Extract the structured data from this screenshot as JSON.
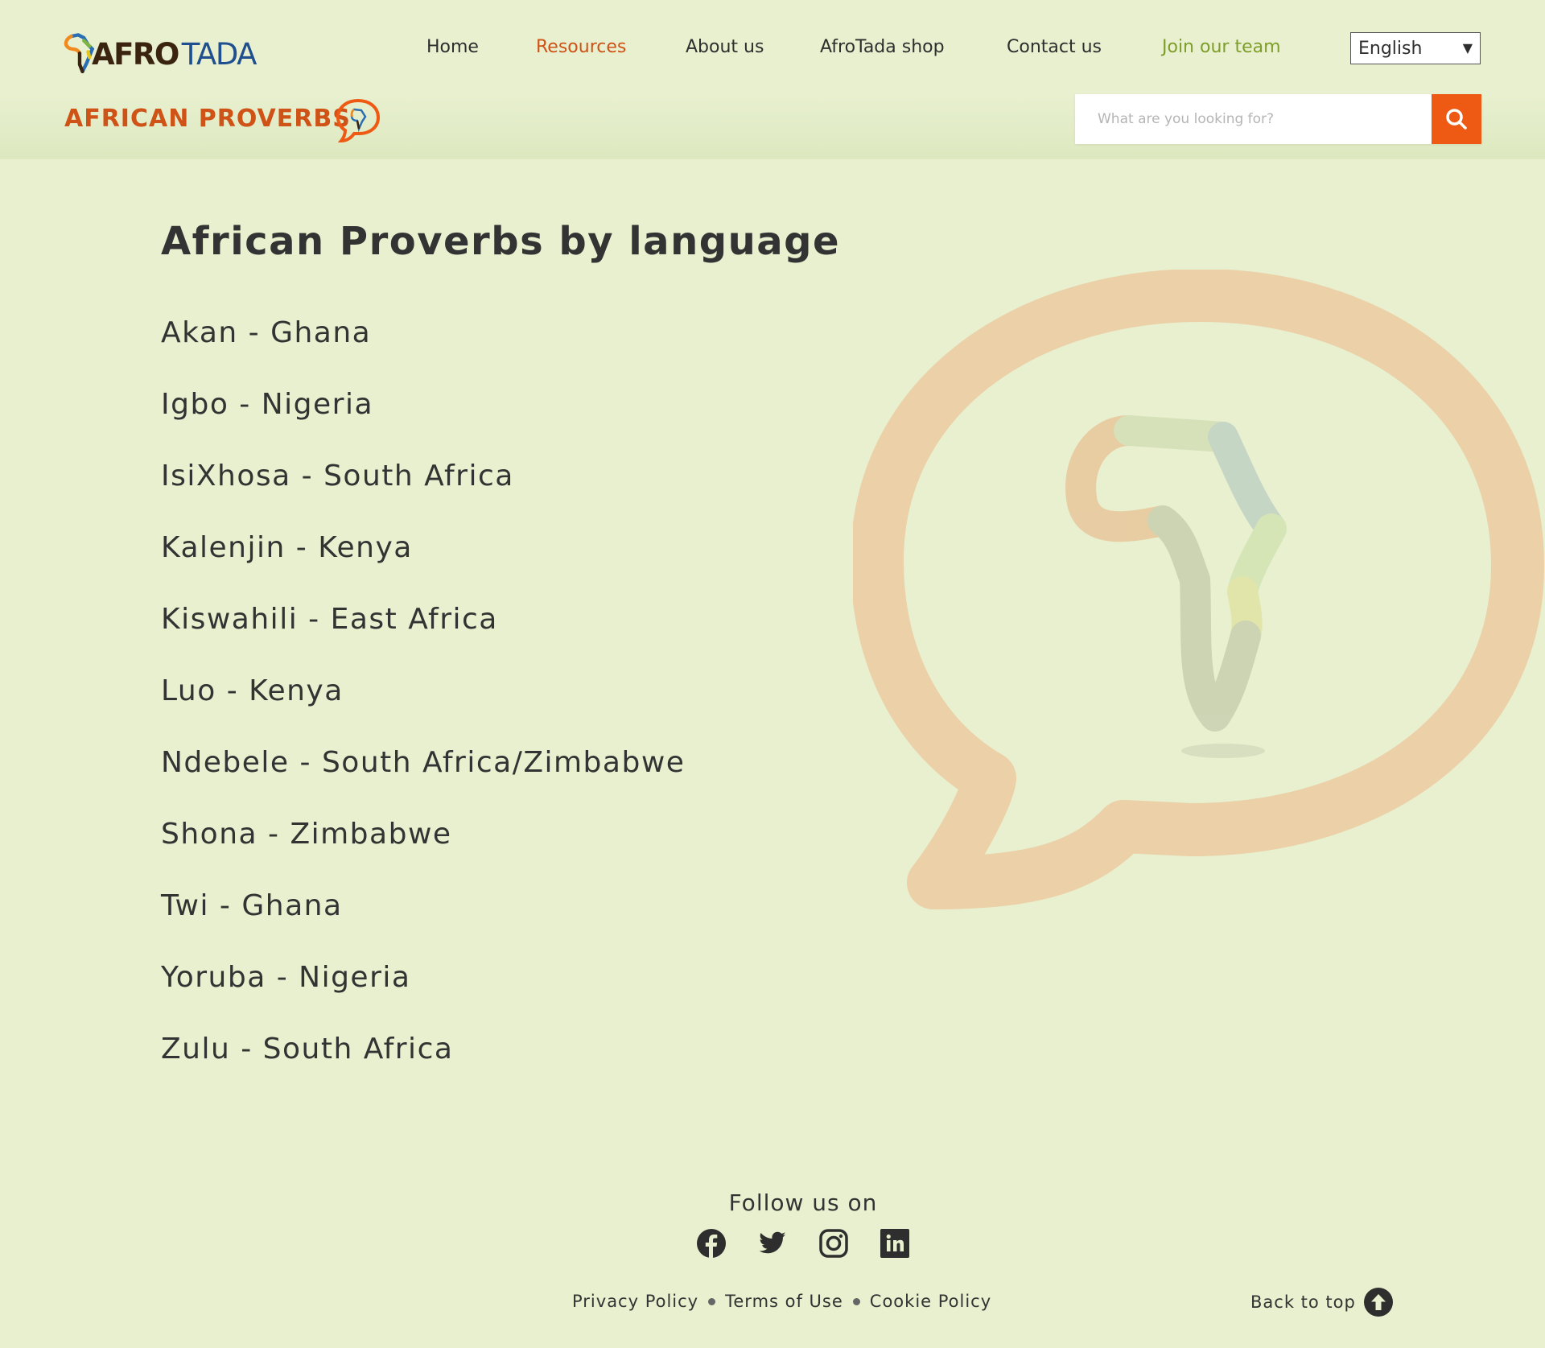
{
  "header": {
    "logo_primary": "AFRO",
    "logo_secondary": "TADA",
    "nav": {
      "home": "Home",
      "resources": "Resources",
      "about": "About us",
      "shop": "AfroTada shop",
      "contact": "Contact us",
      "join": "Join our team"
    },
    "language_selected": "English",
    "section_title": "AFRICAN PROVERBS",
    "search_placeholder": "What are you looking for?"
  },
  "main": {
    "title": "African Proverbs by language",
    "languages": [
      "Akan - Ghana",
      "Igbo - Nigeria",
      "IsiXhosa - South Africa",
      "Kalenjin - Kenya",
      "Kiswahili - East Africa",
      "Luo - Kenya",
      "Ndebele - South Africa/Zimbabwe",
      "Shona - Zimbabwe",
      "Twi - Ghana",
      "Yoruba - Nigeria",
      "Zulu - South Africa"
    ]
  },
  "footer": {
    "follow": "Follow us on",
    "socials": [
      "facebook-icon",
      "twitter-icon",
      "instagram-icon",
      "linkedin-icon"
    ],
    "legal": {
      "privacy": "Privacy Policy",
      "terms": "Terms of Use",
      "cookie": "Cookie Policy"
    },
    "back_to_top": "Back to top"
  },
  "colors": {
    "background": "#e8f0cf",
    "accent_orange": "#ee5a13",
    "title_orange": "#cf5216",
    "join_green": "#7e9e2a",
    "logo_blue": "#1f4f8f"
  }
}
